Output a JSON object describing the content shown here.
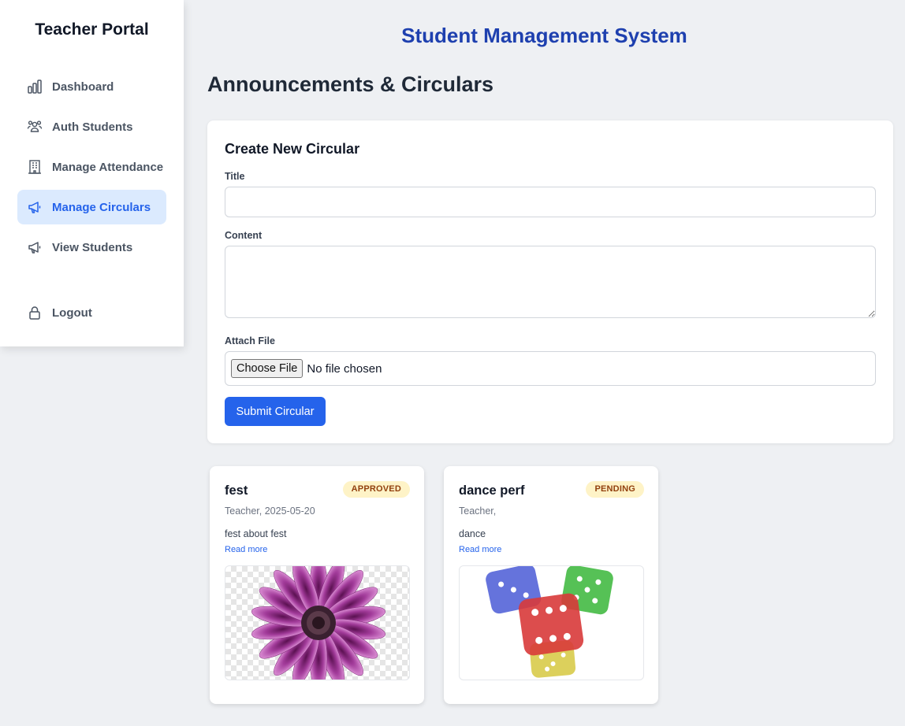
{
  "sidebar": {
    "brand": "Teacher Portal",
    "items": [
      {
        "label": "Dashboard",
        "icon": "bar-chart-icon"
      },
      {
        "label": "Auth Students",
        "icon": "users-icon"
      },
      {
        "label": "Manage Attendance",
        "icon": "building-icon"
      },
      {
        "label": "Manage Circulars",
        "icon": "megaphone-icon",
        "active": true
      },
      {
        "label": "View Students",
        "icon": "megaphone-icon"
      }
    ],
    "logout": {
      "label": "Logout",
      "icon": "lock-icon"
    }
  },
  "header": {
    "system_title": "Student Management System",
    "page_title": "Announcements & Circulars"
  },
  "form": {
    "heading": "Create New Circular",
    "title_label": "Title",
    "title_value": "",
    "content_label": "Content",
    "content_value": "",
    "file_label": "Attach File",
    "choose_button": "Choose File",
    "file_status": "No file chosen",
    "submit_label": "Submit Circular"
  },
  "circulars": [
    {
      "title": "fest",
      "status": "APPROVED",
      "meta": "Teacher, 2025-05-20",
      "body": "fest about fest",
      "link": "Read more",
      "image": "purple-daisy-flower"
    },
    {
      "title": "dance perf",
      "status": "PENDING",
      "meta": "Teacher,",
      "body": "dance",
      "link": "Read more",
      "image": "colored-dice"
    }
  ],
  "colors": {
    "accent": "#2563eb",
    "title_blue": "#1e40af",
    "active_bg": "#dbeafe",
    "badge_bg": "#fef3c7",
    "page_bg": "#eef0f3"
  }
}
